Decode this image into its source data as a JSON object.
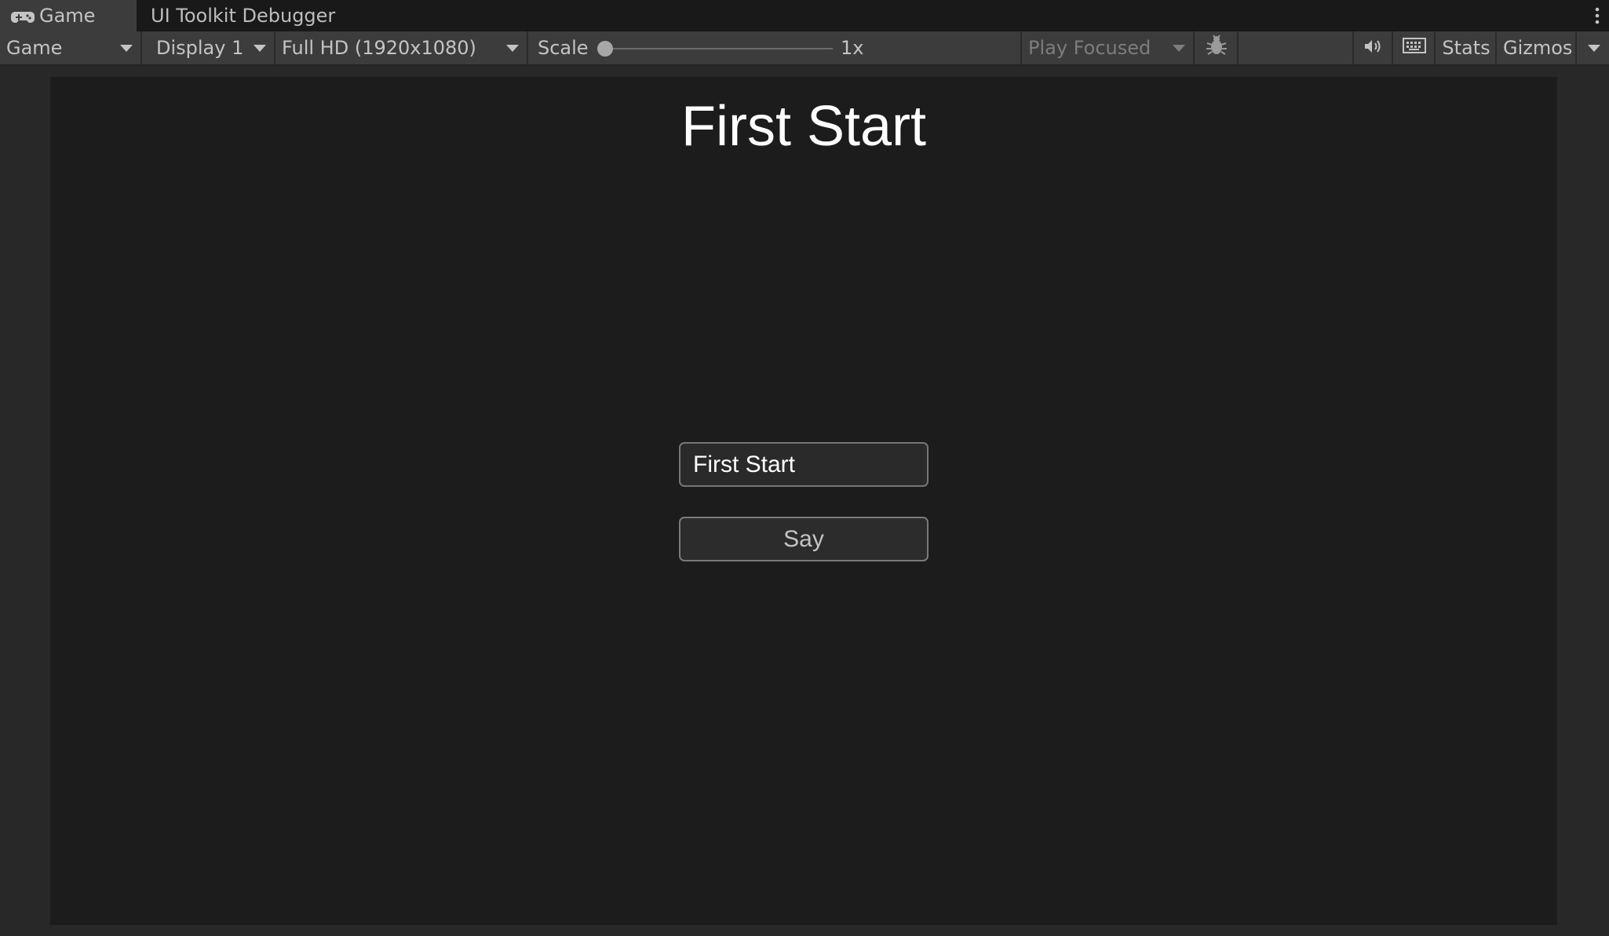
{
  "tabs": {
    "game_label": "Game",
    "debugger_label": "UI Toolkit Debugger"
  },
  "toolbar": {
    "game_dropdown": "Game",
    "display_dropdown": "Display 1",
    "resolution_dropdown": "Full HD (1920x1080)",
    "scale_label": "Scale",
    "scale_value": "1x",
    "scale_level": 0,
    "play_mode_dropdown": "Play Focused",
    "stats_label": "Stats",
    "gizmos_label": "Gizmos"
  },
  "icons": {
    "tab": "gamepad-icon",
    "bug": "bug-icon",
    "audio": "speaker-icon",
    "keyboard": "keyboard-icon",
    "menu": "kebab-menu-icon"
  },
  "game": {
    "title": "First Start",
    "input_value": "First Start",
    "say_button": "Say"
  },
  "colors": {
    "editor_bg": "#282828",
    "tab_bar_bg": "#191919",
    "toolbar_bg": "#3c3c3c",
    "game_bg": "#1c1c1c"
  }
}
